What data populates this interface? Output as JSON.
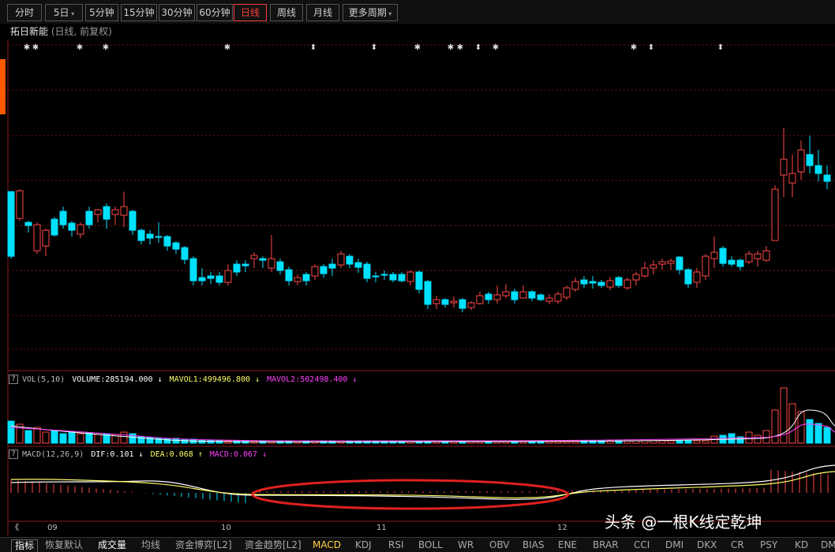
{
  "toolbar": {
    "tabs": [
      "分时",
      "5日",
      "5分钟",
      "15分钟",
      "30分钟",
      "60分钟",
      "日线",
      "周线",
      "月线",
      "更多周期"
    ]
  },
  "header": {
    "stock": "拓日新能",
    "sub": "(日线, 前复权)"
  },
  "vol": {
    "q": "?",
    "label": "VOL(5,10)",
    "volume": "VOLUME:285194.000",
    "ma1": "MAVOL1:499496.800",
    "ma2": "MAVOL2:502498.400",
    "a1": "↓",
    "a2": "↓",
    "a3": "↓"
  },
  "macd": {
    "q": "?",
    "label": "MACD(12,26,9)",
    "dif": "DIF:0.101",
    "dea": "DEA:0.068",
    "m": "MACD:0.067",
    "a1": "↓",
    "a2": "↑",
    "a3": "↓"
  },
  "xaxis": [
    "09",
    "10",
    "11",
    "12"
  ],
  "bottom": {
    "tabs": [
      "指标",
      "恢复默认",
      "成交量",
      "均线",
      "资金博弈[L2]",
      "资金趋势[L2]",
      "MACD",
      "KDJ",
      "RSI",
      "BOLL",
      "WR",
      "OBV",
      "BIAS",
      "ENE",
      "BRAR",
      "CCI",
      "DMI",
      "DKX",
      "CR",
      "PSY",
      "KD",
      "DMI"
    ],
    "active": "MACD"
  },
  "scroll": {
    "left": "《"
  },
  "watermark": "头条 @一根K线定乾坤",
  "markers": {
    "star": "✱",
    "diamond": "⬍"
  },
  "colors": {
    "up": "#ff4747",
    "down": "#00e0ff",
    "grid": "#7a1010",
    "dif": "#ffffff",
    "dea": "#ffff66",
    "ma1": "#ffffff",
    "ma2": "#ff40ff"
  }
}
